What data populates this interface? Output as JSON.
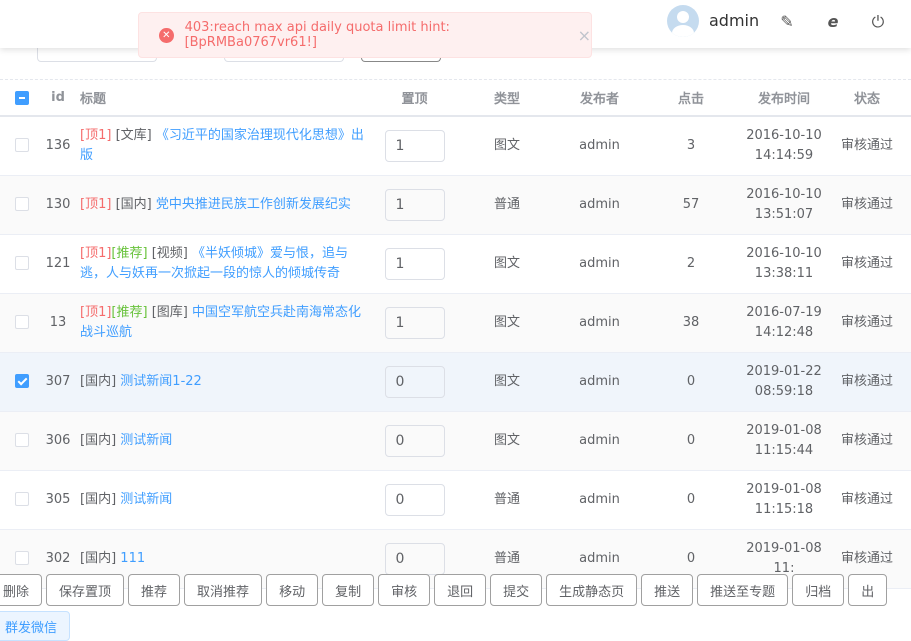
{
  "header": {
    "username": "admin"
  },
  "toast": {
    "message": "403:reach max api daily quota limit hint: [BpRMBa0767vr61!]",
    "close": "×"
  },
  "table": {
    "headers": {
      "id": "id",
      "title": "标题",
      "top": "置顶",
      "type": "类型",
      "publisher": "发布者",
      "clicks": "点击",
      "time": "发布时间",
      "status": "状态"
    },
    "rows": [
      {
        "checked": false,
        "id": "136",
        "tags": [
          {
            "text": "[顶1]",
            "kind": "top"
          }
        ],
        "category": "[文库]",
        "title": "《习近平的国家治理现代化思想》出版",
        "top": "1",
        "type": "图文",
        "publisher": "admin",
        "clicks": "3",
        "time": "2016-10-10 14:14:59",
        "status": "审核通过"
      },
      {
        "checked": false,
        "id": "130",
        "tags": [
          {
            "text": "[顶1]",
            "kind": "top"
          }
        ],
        "category": "[国内]",
        "title": "党中央推进民族工作创新发展纪实",
        "top": "1",
        "type": "普通",
        "publisher": "admin",
        "clicks": "57",
        "time": "2016-10-10 13:51:07",
        "status": "审核通过"
      },
      {
        "checked": false,
        "id": "121",
        "tags": [
          {
            "text": "[顶1]",
            "kind": "top"
          },
          {
            "text": "[推荐]",
            "kind": "rec"
          }
        ],
        "category": "[视频]",
        "title": "《半妖倾城》爱与恨，追与逃，人与妖再一次掀起一段的惊人的倾城传奇",
        "top": "1",
        "type": "图文",
        "publisher": "admin",
        "clicks": "2",
        "time": "2016-10-10 13:38:11",
        "status": "审核通过"
      },
      {
        "checked": false,
        "id": "13",
        "tags": [
          {
            "text": "[顶1]",
            "kind": "top"
          },
          {
            "text": "[推荐]",
            "kind": "rec"
          }
        ],
        "category": "[图库]",
        "title": "中国空军航空兵赴南海常态化战斗巡航",
        "top": "1",
        "type": "图文",
        "publisher": "admin",
        "clicks": "38",
        "time": "2016-07-19 14:12:48",
        "status": "审核通过"
      },
      {
        "checked": true,
        "id": "307",
        "tags": [],
        "category": "[国内]",
        "title": "测试新闻1-22",
        "top": "0",
        "type": "图文",
        "publisher": "admin",
        "clicks": "0",
        "time": "2019-01-22 08:59:18",
        "status": "审核通过"
      },
      {
        "checked": false,
        "id": "306",
        "tags": [],
        "category": "[国内]",
        "title": "测试新闻",
        "top": "0",
        "type": "图文",
        "publisher": "admin",
        "clicks": "0",
        "time": "2019-01-08 11:15:44",
        "status": "审核通过"
      },
      {
        "checked": false,
        "id": "305",
        "tags": [],
        "category": "[国内]",
        "title": "测试新闻",
        "top": "0",
        "type": "普通",
        "publisher": "admin",
        "clicks": "0",
        "time": "2019-01-08 11:15:18",
        "status": "审核通过"
      },
      {
        "checked": false,
        "id": "302",
        "tags": [],
        "category": "[国内]",
        "title": "111",
        "top": "0",
        "type": "普通",
        "publisher": "admin",
        "clicks": "0",
        "time": "2019-01-08 11:",
        "status": "审核通过"
      }
    ]
  },
  "actions": [
    "删除",
    "保存置顶",
    "推荐",
    "取消推荐",
    "移动",
    "复制",
    "审核",
    "退回",
    "提交",
    "生成静态页",
    "推送",
    "推送至专题",
    "归档",
    "出"
  ],
  "wechat": "群发微信"
}
